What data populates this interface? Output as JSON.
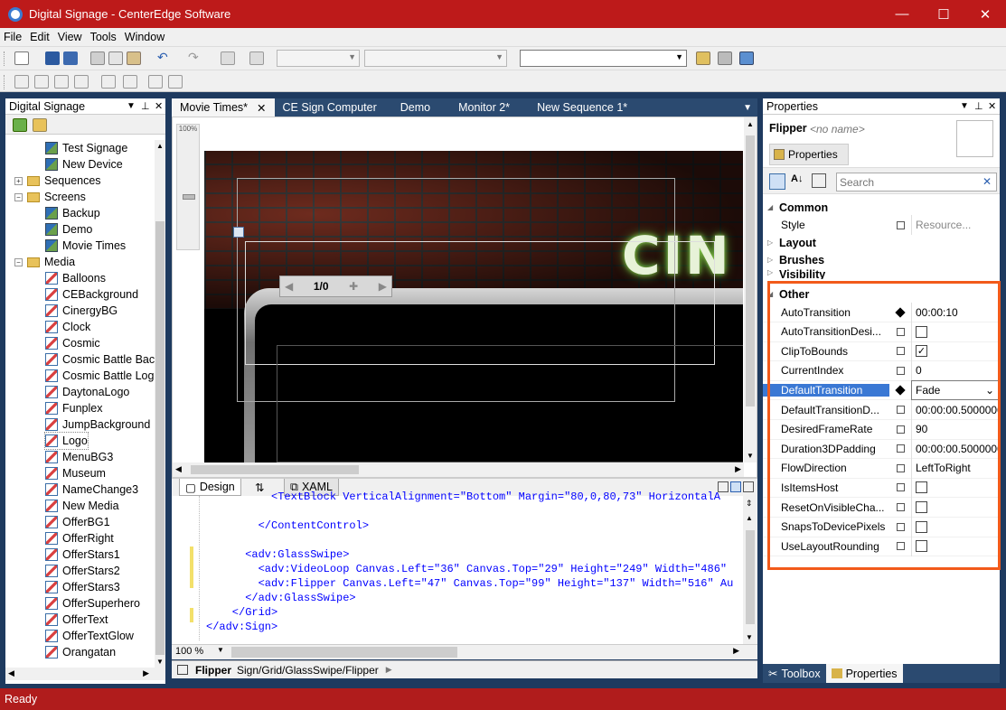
{
  "window": {
    "title": "Digital Signage - CenterEdge Software",
    "min": "—",
    "max": "☐",
    "close": "✕"
  },
  "menu": [
    "File",
    "Edit",
    "View",
    "Tools",
    "Window"
  ],
  "left_panel": {
    "title": "Digital Signage",
    "tree": [
      {
        "label": "Test Signage",
        "type": "screen",
        "level": 3
      },
      {
        "label": "New Device",
        "type": "screen",
        "level": 3
      },
      {
        "label": "Sequences",
        "type": "folder",
        "level": 1
      },
      {
        "label": "Screens",
        "type": "folder",
        "level": 1
      },
      {
        "label": "Backup",
        "type": "screen",
        "level": 2
      },
      {
        "label": "Demo",
        "type": "screen",
        "level": 2
      },
      {
        "label": "Movie Times",
        "type": "screen",
        "level": 2
      },
      {
        "label": "Media",
        "type": "folder",
        "level": 1
      },
      {
        "label": "Balloons",
        "type": "media",
        "level": 2
      },
      {
        "label": "CEBackground",
        "type": "media",
        "level": 2
      },
      {
        "label": "CinergyBG",
        "type": "media",
        "level": 2
      },
      {
        "label": "Clock",
        "type": "media",
        "level": 2
      },
      {
        "label": "Cosmic",
        "type": "media",
        "level": 2
      },
      {
        "label": "Cosmic Battle Bac",
        "type": "media",
        "level": 2
      },
      {
        "label": "Cosmic Battle Log",
        "type": "media",
        "level": 2
      },
      {
        "label": "DaytonaLogo",
        "type": "media",
        "level": 2
      },
      {
        "label": "Funplex",
        "type": "media",
        "level": 2
      },
      {
        "label": "JumpBackground",
        "type": "media",
        "level": 2
      },
      {
        "label": "Logo",
        "type": "media",
        "level": 2
      },
      {
        "label": "MenuBG3",
        "type": "media",
        "level": 2
      },
      {
        "label": "Museum",
        "type": "media",
        "level": 2
      },
      {
        "label": "NameChange3",
        "type": "media",
        "level": 2
      },
      {
        "label": "New Media",
        "type": "media",
        "level": 2
      },
      {
        "label": "OfferBG1",
        "type": "media",
        "level": 2
      },
      {
        "label": "OfferRight",
        "type": "media",
        "level": 2
      },
      {
        "label": "OfferStars1",
        "type": "media",
        "level": 2
      },
      {
        "label": "OfferStars2",
        "type": "media",
        "level": 2
      },
      {
        "label": "OfferStars3",
        "type": "media",
        "level": 2
      },
      {
        "label": "OfferSuperhero",
        "type": "media",
        "level": 2
      },
      {
        "label": "OfferText",
        "type": "media",
        "level": 2
      },
      {
        "label": "OfferTextGlow",
        "type": "media",
        "level": 2
      },
      {
        "label": "Orangatan",
        "type": "media",
        "level": 2
      }
    ]
  },
  "doc_tabs": [
    "Movie Times*",
    "CE Sign Computer",
    "Demo",
    "Monitor 2*",
    "New Sequence 1*"
  ],
  "designer": {
    "zoom_slider": "100%",
    "flipper_index": "1/0",
    "sign_text": "CIN"
  },
  "editor": {
    "tabs": {
      "design": "Design",
      "swap": "⇅",
      "xaml": "XAML"
    },
    "lines": [
      "          <TextBlock VerticalAlignment=\"Bottom\" Margin=\"80,0,80,73\" HorizontalA",
      "        </ContentControl>",
      "",
      "      <adv:GlassSwipe>",
      "        <adv:VideoLoop Canvas.Left=\"36\" Canvas.Top=\"29\" Height=\"249\" Width=\"486\"",
      "        <adv:Flipper Canvas.Left=\"47\" Canvas.Top=\"99\" Height=\"137\" Width=\"516\" Au",
      "      </adv:GlassSwipe>",
      "    </Grid>",
      "</adv:Sign>"
    ],
    "zoom": "100 %"
  },
  "breadcrumb": {
    "element": "Flipper",
    "path": "Sign/Grid/GlassSwipe/Flipper"
  },
  "properties": {
    "title": "Properties",
    "object_type": "Flipper",
    "object_name": "<no name>",
    "tab": "Properties",
    "search_placeholder": "Search",
    "categories": {
      "common": "Common",
      "layout": "Layout",
      "brushes": "Brushes",
      "visibility": "Visibility",
      "other": "Other"
    },
    "style": {
      "name": "Style",
      "value": "Resource..."
    },
    "rows": [
      {
        "name": "AutoTransition",
        "value": "00:00:10",
        "marker": "diamond",
        "kind": "text"
      },
      {
        "name": "AutoTransitionDesi...",
        "value": "",
        "marker": "square",
        "kind": "check",
        "checked": false
      },
      {
        "name": "ClipToBounds",
        "value": "",
        "marker": "square",
        "kind": "check",
        "checked": true
      },
      {
        "name": "CurrentIndex",
        "value": "0",
        "marker": "square",
        "kind": "text"
      },
      {
        "name": "DefaultTransition",
        "value": "Fade",
        "marker": "diamond",
        "kind": "select",
        "selected": true
      },
      {
        "name": "DefaultTransitionD...",
        "value": "00:00:00.5000000",
        "marker": "square",
        "kind": "text"
      },
      {
        "name": "DesiredFrameRate",
        "value": "90",
        "marker": "square",
        "kind": "text"
      },
      {
        "name": "Duration3DPadding",
        "value": "00:00:00.5000000",
        "marker": "square",
        "kind": "text"
      },
      {
        "name": "FlowDirection",
        "value": "LeftToRight",
        "marker": "square",
        "kind": "text"
      },
      {
        "name": "IsItemsHost",
        "value": "",
        "marker": "square",
        "kind": "check",
        "checked": false
      },
      {
        "name": "ResetOnVisibleCha...",
        "value": "",
        "marker": "square",
        "kind": "check",
        "checked": false
      },
      {
        "name": "SnapsToDevicePixels",
        "value": "",
        "marker": "square",
        "kind": "check",
        "checked": false
      },
      {
        "name": "UseLayoutRounding",
        "value": "",
        "marker": "square",
        "kind": "check",
        "checked": false
      }
    ]
  },
  "bottom_tabs": [
    "Toolbox",
    "Properties"
  ],
  "status": "Ready",
  "colors": {
    "title_red": "#bd1a1a",
    "frame_blue": "#1e3a5f",
    "highlight": "#f25a1a",
    "selection": "#3a78d4"
  }
}
